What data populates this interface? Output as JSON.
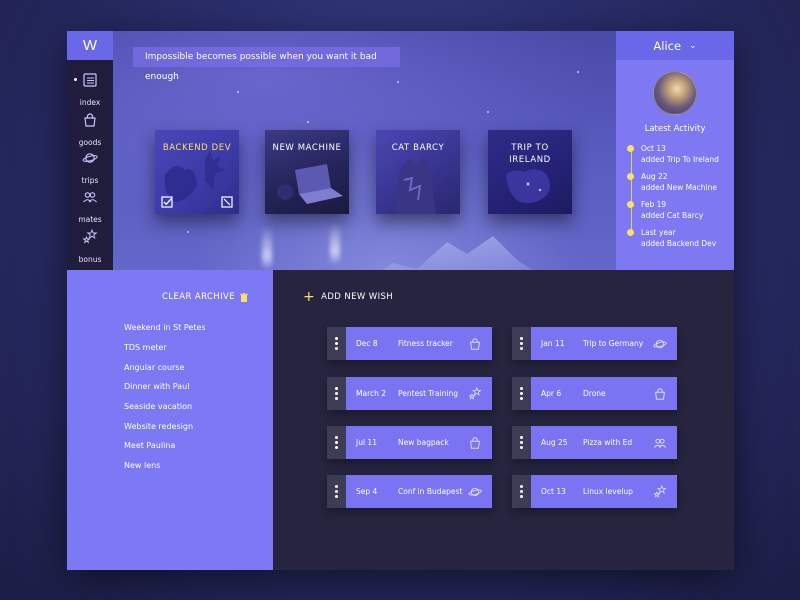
{
  "sidebar": {
    "logo": "W",
    "items": [
      {
        "label": "index",
        "icon": "list-icon",
        "active": true
      },
      {
        "label": "goods",
        "icon": "shopping-bag-icon"
      },
      {
        "label": "trips",
        "icon": "planet-icon"
      },
      {
        "label": "mates",
        "icon": "people-icon"
      },
      {
        "label": "bonus",
        "icon": "stars-icon"
      }
    ]
  },
  "header": {
    "quote": "Impossible becomes possible when you want it bad enough"
  },
  "cards": [
    {
      "title": "BACKEND DEV",
      "highlight": true
    },
    {
      "title": "NEW MACHINE"
    },
    {
      "title": "CAT BARCY"
    },
    {
      "title": "TRIP TO IRELAND"
    }
  ],
  "activity": {
    "user": "Alice",
    "title": "Latest Activity",
    "items": [
      {
        "date": "Oct 13",
        "text": "added Trip To Ireland"
      },
      {
        "date": "Aug  22",
        "text": "added New Machine"
      },
      {
        "date": "Feb 19",
        "text": "added Cat Barcy"
      },
      {
        "date": "Last year",
        "text": "added Backend Dev"
      }
    ]
  },
  "archive": {
    "clear_label": "CLEAR ARCHIVE",
    "items": [
      "Weekend in St Petes",
      "TDS meter",
      "Angular course",
      "Dinner with Paul",
      "Seaside vacation",
      "Website redesign",
      "Meet Paulina",
      "New lens"
    ]
  },
  "wishes": {
    "add_label": "ADD NEW WISH",
    "items": [
      {
        "date": "Dec 8",
        "name": "Fitness tracker",
        "icon": "shopping-bag-icon"
      },
      {
        "date": "Jan 11",
        "name": "Trip to Germany",
        "icon": "planet-icon"
      },
      {
        "date": "March 2",
        "name": "Pentest Training",
        "icon": "stars-icon"
      },
      {
        "date": "Apr 6",
        "name": "Drone",
        "icon": "shopping-bag-icon"
      },
      {
        "date": "Jul 11",
        "name": "New bagpack",
        "icon": "shopping-bag-icon"
      },
      {
        "date": "Aug 25",
        "name": "Pizza with Ed",
        "icon": "people-icon"
      },
      {
        "date": "Sep 4",
        "name": "Conf in Budapest",
        "icon": "planet-icon"
      },
      {
        "date": "Oct 13",
        "name": "Linux levelup",
        "icon": "stars-icon"
      }
    ]
  },
  "colors": {
    "accent": "#7a74f2",
    "highlight": "#ffe066",
    "dark": "#26243e",
    "sidebar": "#1f1c3c"
  }
}
